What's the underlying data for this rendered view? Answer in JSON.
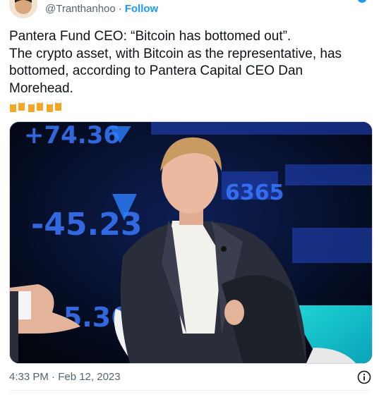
{
  "tweet": {
    "handle": "@Tranthanhoo",
    "separator": "·",
    "follow_label": "Follow",
    "text_line1": "Pantera Fund CEO: “Bitcoin has bottomed out”.",
    "text_line2": "The crypto asset, with Bitcoin as the representative, has bottomed, according to Pantera Capital CEO Dan Morehead.",
    "emojis": [
      "beer-mugs-emoji",
      "beer-mugs-emoji",
      "beer-mugs-emoji"
    ],
    "timestamp": "4:33 PM · Feb 12, 2023"
  },
  "media": {
    "ticker_values": [
      "+74.36",
      "-45.23",
      "6365",
      "-5.36"
    ]
  },
  "colors": {
    "accent": "#1d9bf0",
    "secondary_text": "#536471"
  }
}
